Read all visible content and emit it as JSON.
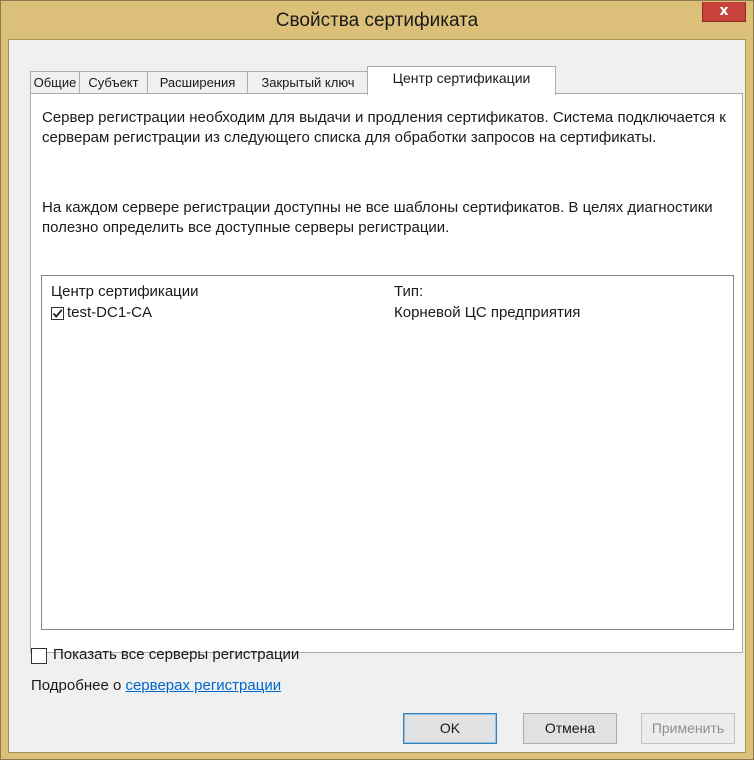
{
  "window": {
    "title": "Свойства сертификата",
    "close_glyph": "x"
  },
  "tabs": [
    {
      "label": "Общие"
    },
    {
      "label": "Субъект"
    },
    {
      "label": "Расширения"
    },
    {
      "label": "Закрытый ключ"
    },
    {
      "label": "Центр сертификации",
      "active": true
    }
  ],
  "panel": {
    "paragraph1": "Сервер регистрации необходим для выдачи и продления сертификатов. Система подключается к серверам регистрации из следующего списка для обработки запросов на сертификаты.",
    "paragraph2": "На каждом сервере регистрации доступны не все шаблоны сертификатов. В целях диагностики полезно определить все доступные серверы регистрации.",
    "list": {
      "columns": [
        "Центр сертификации",
        "Тип:"
      ],
      "rows": [
        {
          "checked": true,
          "name": "test-DC1-CA",
          "type": "Корневой ЦС предприятия"
        }
      ]
    },
    "show_all_label": "Показать все серверы регистрации",
    "show_all_checked": false,
    "more_prefix": "Подробнее о ",
    "more_link": "серверах регистрации"
  },
  "buttons": {
    "ok": "OK",
    "cancel": "Отмена",
    "apply": "Применить"
  }
}
